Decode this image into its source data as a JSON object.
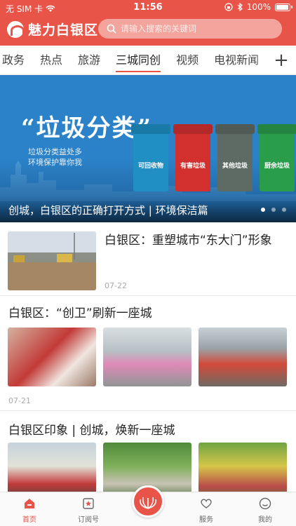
{
  "status_bar": {
    "carrier": "无 SIM 卡",
    "time": "11:56",
    "battery": "100%"
  },
  "header": {
    "app_name": "魅力白银区",
    "search_placeholder": "请输入搜索的关键词"
  },
  "tabs": [
    {
      "label": "政务"
    },
    {
      "label": "热点"
    },
    {
      "label": "旅游"
    },
    {
      "label": "三城同创",
      "active": true
    },
    {
      "label": "视频"
    },
    {
      "label": "电视新闻"
    }
  ],
  "tab_add": "+",
  "banner": {
    "headline": "“垃圾分类”",
    "slogan_line1": "垃圾分类益处多",
    "slogan_line2": "环境保护靠你我",
    "bins": [
      {
        "label": "可回收物",
        "color": "#1f8fc4"
      },
      {
        "label": "有害垃圾",
        "color": "#d22f2f"
      },
      {
        "label": "其他垃圾",
        "color": "#5e6b64"
      },
      {
        "label": "厨余垃圾",
        "color": "#2a9d4b"
      }
    ],
    "caption": "创城，白银区的正确打开方式 | 环境保洁篇",
    "slide_count": 3,
    "active_slide": 1
  },
  "feed": {
    "item1": {
      "title": "白银区：重塑城市“东大门”形象",
      "date": "07-22"
    },
    "item2": {
      "title": "白银区：“创卫”刷新一座城",
      "date": "07-21"
    },
    "item3": {
      "title": "白银区印象 | 创城，焕新一座城"
    }
  },
  "bottom_nav": {
    "home": "首页",
    "subscribe": "订阅号",
    "service": "服务",
    "mine": "我的"
  },
  "colors": {
    "brand": "#e85448"
  }
}
